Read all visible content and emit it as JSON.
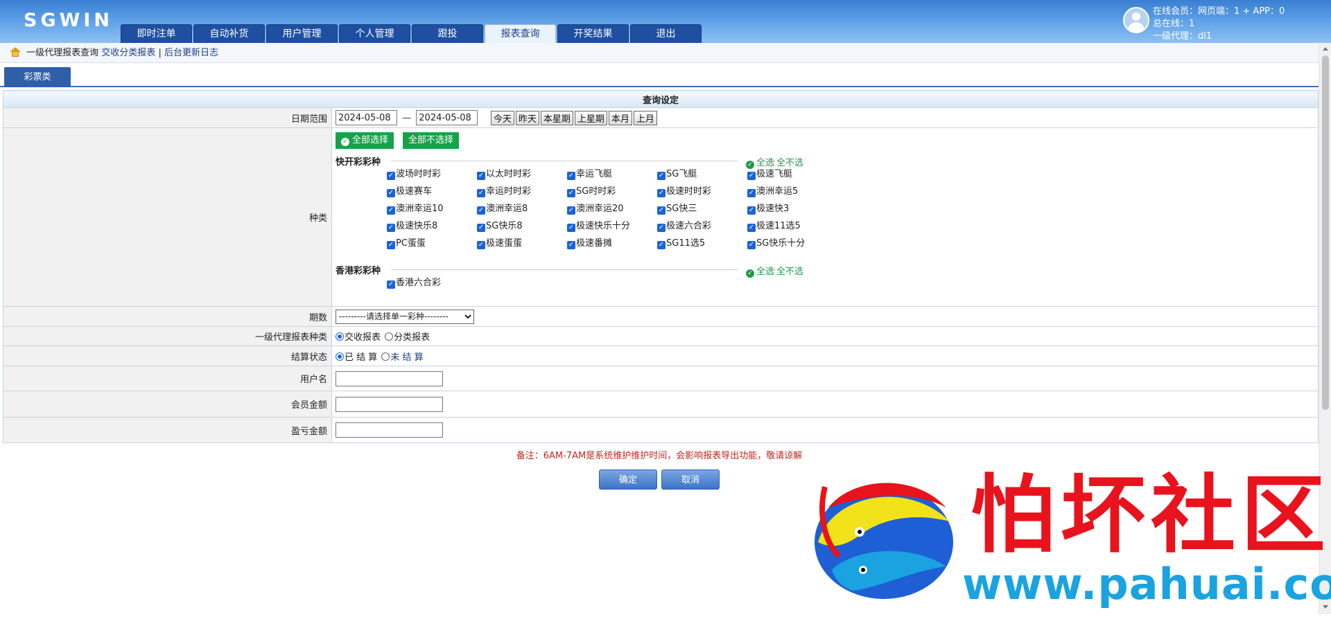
{
  "app": {
    "logo": "SGWIN"
  },
  "nav": {
    "tabs": [
      {
        "label": "即时注单"
      },
      {
        "label": "自动补货"
      },
      {
        "label": "用户管理"
      },
      {
        "label": "个人管理"
      },
      {
        "label": "跟投"
      },
      {
        "label": "报表查询",
        "active": true
      },
      {
        "label": "开奖结果"
      },
      {
        "label": "退出"
      }
    ]
  },
  "user": {
    "online": "在线会员：网页端：1 + APP：0",
    "total": "总在线：1",
    "agent": "一级代理：dl1"
  },
  "breadcrumb": {
    "current": "一级代理报表查询",
    "link_classify": "交收分类报表",
    "separator": "|",
    "link_log": "后台更新日志"
  },
  "subtab": {
    "label": "彩票类"
  },
  "form": {
    "caption": "查询设定",
    "date": {
      "label": "日期范围",
      "start": "2024-05-08",
      "dash": "—",
      "end": "2024-05-08",
      "quick": [
        "今天",
        "昨天",
        "本星期",
        "上星期",
        "本月",
        "上月"
      ]
    },
    "types": {
      "label": "种类",
      "select_all": "全部选择",
      "select_none": "全部不选择",
      "groups": [
        {
          "title": "快开彩彩种",
          "all": "全选",
          "none": "全不选",
          "items": [
            "波场时时彩",
            "以太时时彩",
            "幸运飞艇",
            "SG飞艇",
            "极速飞艇",
            "极速赛车",
            "幸运时时彩",
            "SG时时彩",
            "极速时时彩",
            "澳洲幸运5",
            "澳洲幸运10",
            "澳洲幸运8",
            "澳洲幸运20",
            "SG快三",
            "极速快3",
            "极速快乐8",
            "SG快乐8",
            "极速快乐十分",
            "极速六合彩",
            "极速11选5",
            "PC蛋蛋",
            "极速蛋蛋",
            "极速番摊",
            "SG11选5",
            "SG快乐十分"
          ]
        },
        {
          "title": "香港彩彩种",
          "all": "全选",
          "none": "全不选",
          "items": [
            "香港六合彩"
          ]
        }
      ]
    },
    "period": {
      "label": "期数",
      "selected": "---------请选择单一彩种--------"
    },
    "report_type": {
      "label": "一级代理报表种类",
      "option1": "交收报表",
      "option2": "分类报表"
    },
    "settle": {
      "label": "结算状态",
      "option1": "已 结 算",
      "option2": "未 结 算"
    },
    "username": {
      "label": "用户名",
      "value": ""
    },
    "member_amount": {
      "label": "会员金额",
      "value": ""
    },
    "profit_amount": {
      "label": "盈亏金额",
      "value": ""
    }
  },
  "note": "备注：6AM-7AM是系统维护维护时间，会影响报表导出功能，敬请谅解",
  "actions": {
    "confirm": "确定",
    "cancel": "取消"
  },
  "watermark": {
    "title": "怕坏社区",
    "url": "www.pahuai.com"
  },
  "colors": {
    "header": "#3a7fd0",
    "nav_tab": "#1e4fa0",
    "green": "#15a34a",
    "note": "#c0281e",
    "wm_red": "#e8131c",
    "wm_blue": "#1aa3e0"
  }
}
